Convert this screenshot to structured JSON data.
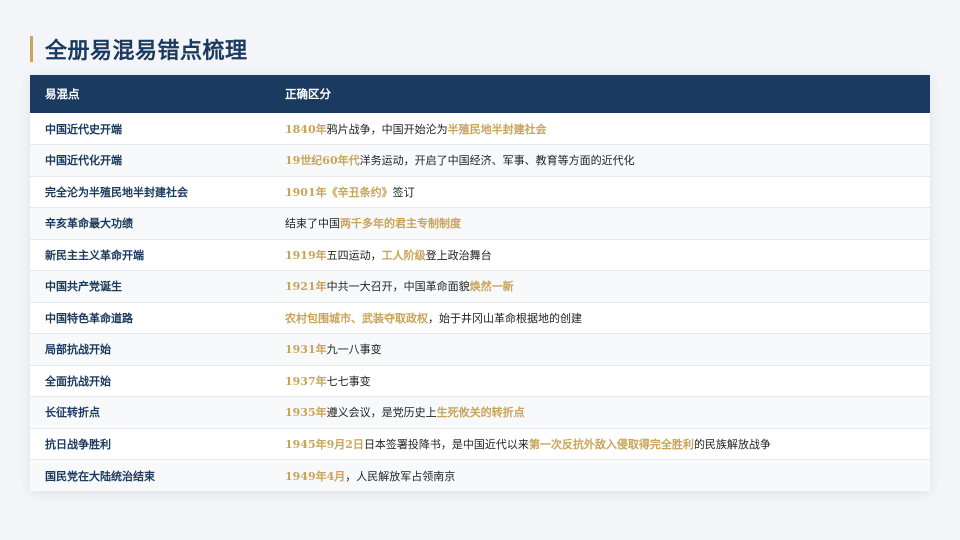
{
  "title": "全册易混易错点梳理",
  "colors": {
    "navy": "#1b3a5f",
    "gold": "#c9a45a"
  },
  "table": {
    "headers": [
      "易混点",
      "正确区分"
    ],
    "rows": [
      {
        "point": "中国近代史开端",
        "parts": [
          [
            "1840年",
            true
          ],
          [
            "鸦片战争，中国开始沦为",
            false
          ],
          [
            "半殖民地半封建社会",
            true
          ]
        ]
      },
      {
        "point": "中国近代化开端",
        "parts": [
          [
            "19世纪60年代",
            true
          ],
          [
            "洋务运动，开启了中国经济、军事、教育等方面的近代化",
            false
          ]
        ]
      },
      {
        "point": "完全沦为半殖民地半封建社会",
        "parts": [
          [
            "1901年《辛丑条约》",
            true
          ],
          [
            "签订",
            false
          ]
        ]
      },
      {
        "point": "辛亥革命最大功绩",
        "parts": [
          [
            "结束了中国",
            false
          ],
          [
            "两千多年的君主专制制度",
            true
          ]
        ]
      },
      {
        "point": "新民主主义革命开端",
        "parts": [
          [
            "1919年",
            true
          ],
          [
            "五四运动，",
            false
          ],
          [
            "工人阶级",
            true
          ],
          [
            "登上政治舞台",
            false
          ]
        ]
      },
      {
        "point": "中国共产党诞生",
        "parts": [
          [
            "1921年",
            true
          ],
          [
            "中共一大召开，中国革命面貌",
            false
          ],
          [
            "焕然一新",
            true
          ]
        ]
      },
      {
        "point": "中国特色革命道路",
        "parts": [
          [
            "农村包围城市、武装夺取政权",
            true
          ],
          [
            "，始于井冈山革命根据地的创建",
            false
          ]
        ]
      },
      {
        "point": "局部抗战开始",
        "parts": [
          [
            "1931年",
            true
          ],
          [
            "九一八事变",
            false
          ]
        ]
      },
      {
        "point": "全面抗战开始",
        "parts": [
          [
            "1937年",
            true
          ],
          [
            "七七事变",
            false
          ]
        ]
      },
      {
        "point": "长征转折点",
        "parts": [
          [
            "1935年",
            true
          ],
          [
            "遵义会议，是党历史上",
            false
          ],
          [
            "生死攸关的转折点",
            true
          ]
        ]
      },
      {
        "point": "抗日战争胜利",
        "parts": [
          [
            "1945年9月2日",
            true
          ],
          [
            "日本签署投降书，是中国近代以来",
            false
          ],
          [
            "第一次反抗外敌入侵取得完全胜利",
            true
          ],
          [
            "的民族解放战争",
            false
          ]
        ]
      },
      {
        "point": "国民党在大陆统治结束",
        "parts": [
          [
            "1949年4月",
            true
          ],
          [
            "，人民解放军占领南京",
            false
          ]
        ]
      }
    ]
  }
}
